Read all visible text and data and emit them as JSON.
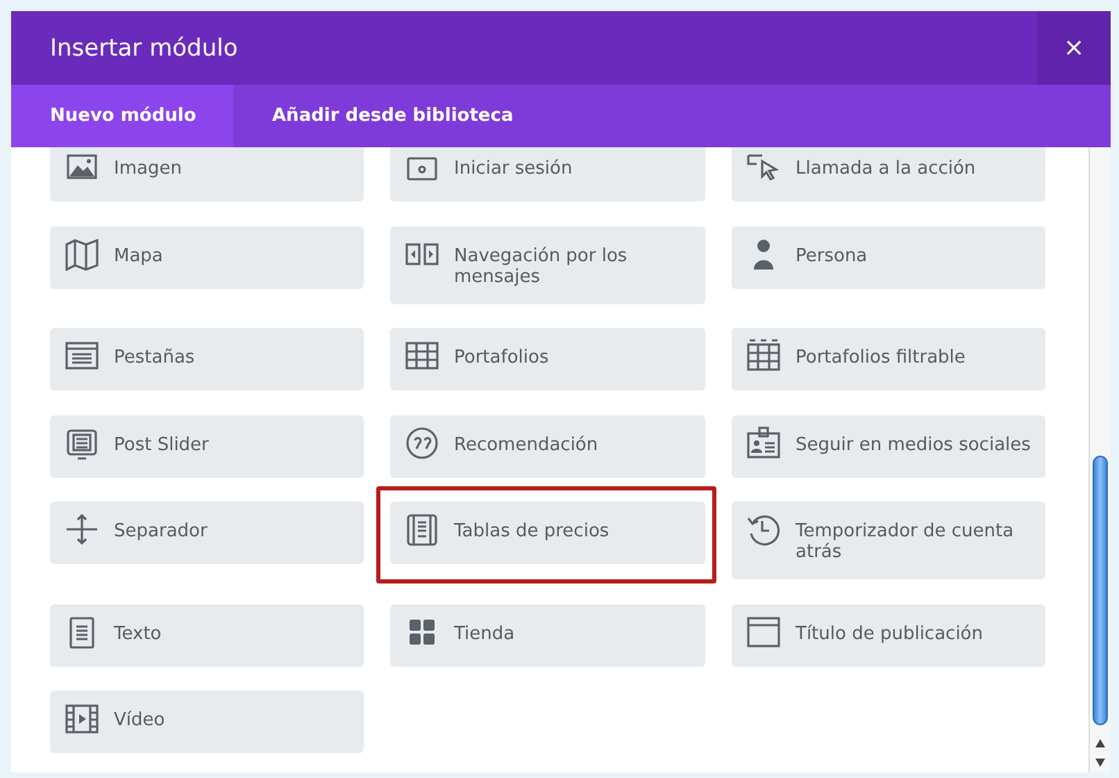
{
  "window": {
    "title": "Insertar módulo",
    "close": "×"
  },
  "tabs": [
    {
      "label": "Nuevo módulo",
      "selected": true
    },
    {
      "label": "Añadir desde biblioteca",
      "selected": false
    }
  ],
  "modules": [
    {
      "label": "Imagen",
      "highlighted": false
    },
    {
      "label": "Iniciar sesión",
      "highlighted": false
    },
    {
      "label": "Llamada a la acción",
      "highlighted": false
    },
    {
      "label": "Mapa",
      "highlighted": false
    },
    {
      "label": "Navegación por los mensajes",
      "highlighted": false
    },
    {
      "label": "Persona",
      "highlighted": false
    },
    {
      "label": "Pestañas",
      "highlighted": false
    },
    {
      "label": "Portafolios",
      "highlighted": false
    },
    {
      "label": "Portafolios filtrable",
      "highlighted": false
    },
    {
      "label": "Post Slider",
      "highlighted": false
    },
    {
      "label": "Recomendación",
      "highlighted": false
    },
    {
      "label": "Seguir en medios sociales",
      "highlighted": false
    },
    {
      "label": "Separador",
      "highlighted": false
    },
    {
      "label": "Tablas de precios",
      "highlighted": true
    },
    {
      "label": "Temporizador de cuenta atrás",
      "highlighted": false
    },
    {
      "label": "Texto",
      "highlighted": false
    },
    {
      "label": "Tienda",
      "highlighted": false
    },
    {
      "label": "Título de publicación",
      "highlighted": false
    },
    {
      "label": "Vídeo",
      "highlighted": false
    }
  ]
}
